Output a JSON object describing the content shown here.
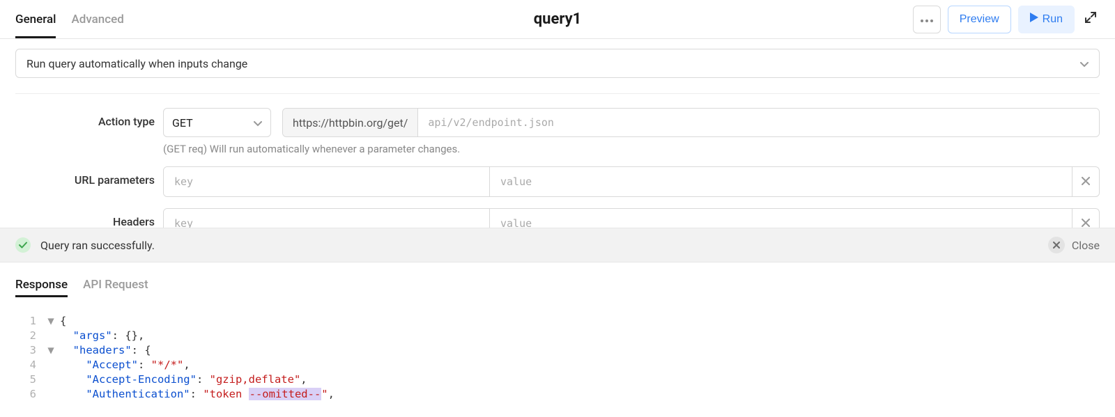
{
  "header": {
    "tabs": [
      "General",
      "Advanced"
    ],
    "active_tab": 0,
    "title": "query1",
    "actions": {
      "more": "…",
      "preview": "Preview",
      "run": "Run"
    }
  },
  "run_mode": {
    "label": "Run query automatically when inputs change"
  },
  "form": {
    "action_type": {
      "label": "Action type",
      "method": "GET",
      "base_url": "https://httpbin.org/get/",
      "path_placeholder": "api/v2/endpoint.json",
      "hint": "(GET req) Will run automatically whenever a parameter changes."
    },
    "url_params": {
      "label": "URL parameters",
      "key_placeholder": "key",
      "value_placeholder": "value"
    },
    "headers": {
      "label": "Headers",
      "key_placeholder": "key",
      "value_placeholder": "value"
    }
  },
  "status": {
    "message": "Query ran successfully.",
    "close_label": "Close"
  },
  "response_tabs": {
    "tabs": [
      "Response",
      "API Request"
    ],
    "active_tab": 0
  },
  "response_json_tokens": [
    {
      "ln": 1,
      "fold": "▼",
      "indent": 0,
      "tokens": [
        [
          "punc",
          "{"
        ]
      ]
    },
    {
      "ln": 2,
      "fold": "",
      "indent": 1,
      "tokens": [
        [
          "key",
          "\"args\""
        ],
        [
          "punc",
          ": "
        ],
        [
          "punc",
          "{}"
        ],
        [
          "punc",
          ","
        ]
      ]
    },
    {
      "ln": 3,
      "fold": "▼",
      "indent": 1,
      "tokens": [
        [
          "key",
          "\"headers\""
        ],
        [
          "punc",
          ": "
        ],
        [
          "punc",
          "{"
        ]
      ]
    },
    {
      "ln": 4,
      "fold": "",
      "indent": 2,
      "tokens": [
        [
          "key",
          "\"Accept\""
        ],
        [
          "punc",
          ": "
        ],
        [
          "str",
          "\"*/*\""
        ],
        [
          "punc",
          ","
        ]
      ]
    },
    {
      "ln": 5,
      "fold": "",
      "indent": 2,
      "tokens": [
        [
          "key",
          "\"Accept-Encoding\""
        ],
        [
          "punc",
          ": "
        ],
        [
          "str",
          "\"gzip,deflate\""
        ],
        [
          "punc",
          ","
        ]
      ]
    },
    {
      "ln": 6,
      "fold": "",
      "indent": 2,
      "tokens": [
        [
          "key",
          "\"Authentication\""
        ],
        [
          "punc",
          ": "
        ],
        [
          "str",
          "\"token "
        ],
        [
          "hl",
          "--omitted--"
        ],
        [
          "str",
          "\""
        ],
        [
          "punc",
          ","
        ]
      ]
    }
  ]
}
